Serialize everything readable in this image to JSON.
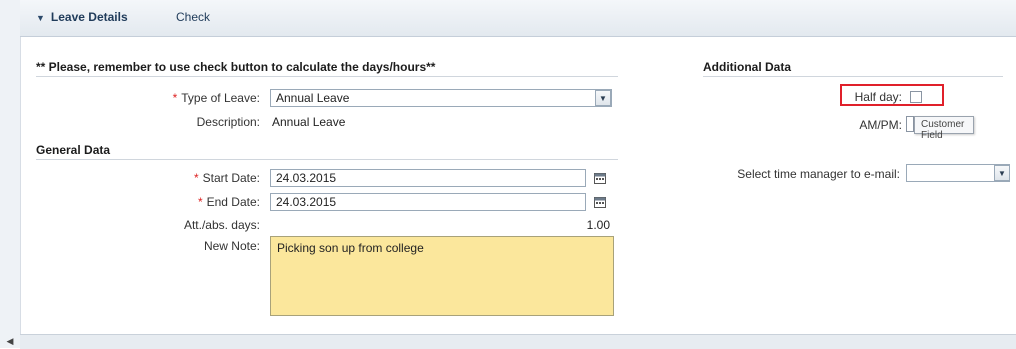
{
  "toolbar": {
    "leave_details_label": "Leave Details",
    "check_label": "Check"
  },
  "notice": "** Please, remember to use check button to calculate the days/hours**",
  "leave": {
    "type_label": "Type of Leave:",
    "type_value": "Annual Leave",
    "description_label": "Description:",
    "description_value": "Annual Leave"
  },
  "general": {
    "heading": "General Data",
    "start_label": "Start Date:",
    "start_value": "24.03.2015",
    "end_label": "End Date:",
    "end_value": "24.03.2015",
    "days_label": "Att./abs. days:",
    "days_value": "1.00",
    "note_label": "New Note:",
    "note_value": "Picking son up from college"
  },
  "additional": {
    "heading": "Additional Data",
    "half_day_label": "Half day:",
    "ampm_label": "AM/PM:",
    "tooltip": "Customer Field",
    "time_manager_label": "Select time manager to e-mail:",
    "time_manager_value": ""
  },
  "colors": {
    "required": "#d22222",
    "note_bg": "#fbe79c",
    "highlight": "#e0202a"
  }
}
